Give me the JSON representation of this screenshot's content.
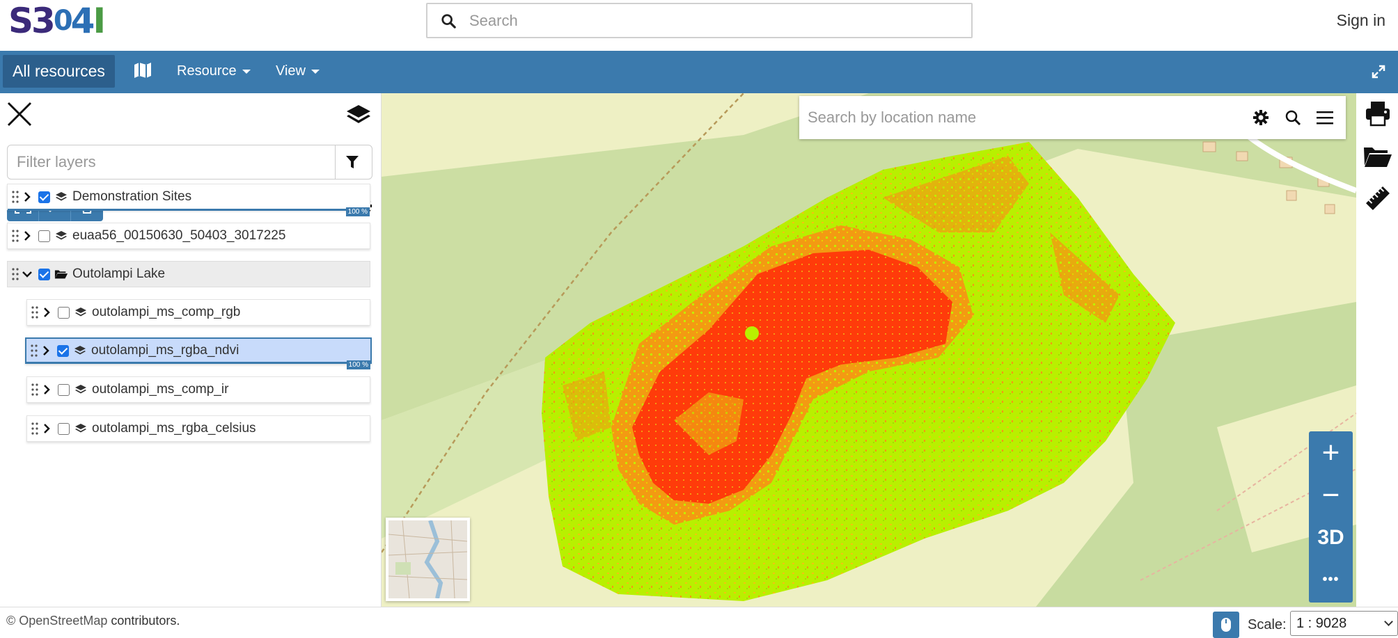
{
  "header": {
    "logo_text": "S3O4I",
    "search_placeholder": "Search",
    "sign_in": "Sign in"
  },
  "nav": {
    "home": "All resources",
    "resource": "Resource",
    "view": "View"
  },
  "panel": {
    "filter_placeholder": "Filter layers",
    "layers": [
      {
        "label": "Demonstration Sites",
        "checked": true,
        "opacity": "100 %"
      },
      {
        "label": "euaa56_00150630_50403_3017225",
        "checked": false
      },
      {
        "label": "Outolampi Lake",
        "checked": true,
        "type": "group"
      },
      {
        "label": "outolampi_ms_comp_rgb",
        "checked": false
      },
      {
        "label": "outolampi_ms_rgba_ndvi",
        "checked": true,
        "selected": true,
        "opacity": "100 %"
      },
      {
        "label": "outolampi_ms_comp_ir",
        "checked": false
      },
      {
        "label": "outolampi_ms_rgba_celsius",
        "checked": false
      }
    ]
  },
  "map": {
    "search_placeholder": "Search by location name",
    "zoom_in": "+",
    "zoom_out": "−",
    "mode_3d": "3D",
    "more": "•••"
  },
  "footer": {
    "attribution_osm": "© OpenStreetMap",
    "attribution_rest": " contributors.",
    "scale_label": "Scale:",
    "scale_value": "1 : 9028"
  },
  "colors": {
    "primary": "#3b7aad",
    "primary_dark": "#2c5f8c",
    "selected_row": "#c8dbfb",
    "ndvi_high": "#b8f000",
    "ndvi_mid": "#f39a12",
    "ndvi_low": "#ff3b0a"
  }
}
